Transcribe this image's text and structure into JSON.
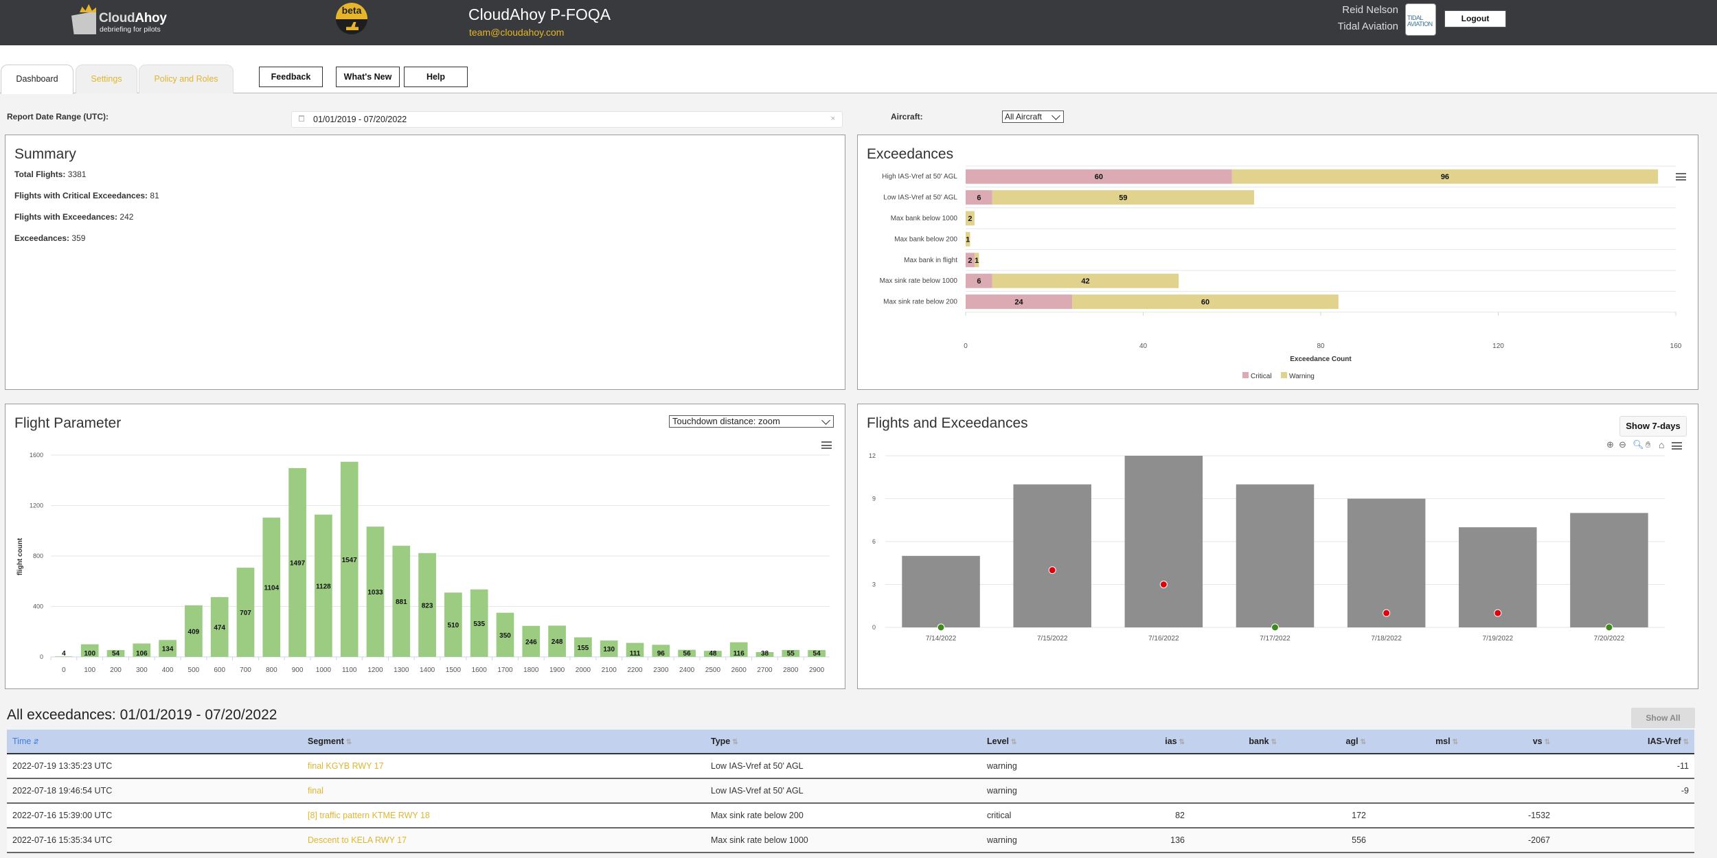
{
  "header": {
    "brand": "Cloud",
    "brand_bold": "Ahoy",
    "tagline": "debriefing for pilots",
    "beta_label": "beta",
    "app_title": "CloudAhoy P-FOQA",
    "contact_email": "team@cloudahoy.com",
    "user_name": "Reid Nelson",
    "organization": "Tidal Aviation",
    "org_logo_text": "TIDAL AVIATION",
    "logout_label": "Logout"
  },
  "tabs": [
    {
      "label": "Dashboard",
      "active": true
    },
    {
      "label": "Settings",
      "active": false
    },
    {
      "label": "Policy and Roles",
      "active": false
    }
  ],
  "top_buttons": [
    "Feedback",
    "What's New",
    "Help"
  ],
  "filters": {
    "date_range_label": "Report Date Range (UTC):",
    "date_range_value": "01/01/2019 - 07/20/2022",
    "clear_label": "×",
    "aircraft_label": "Aircraft:",
    "aircraft_value": "All Aircraft"
  },
  "summary": {
    "title": "Summary",
    "items": [
      {
        "label": "Total Flights:",
        "value": "3381"
      },
      {
        "label": "Flights with Critical Exceedances:",
        "value": "81"
      },
      {
        "label": "Flights with Exceedances:",
        "value": "242"
      },
      {
        "label": "Exceedances:",
        "value": "359"
      }
    ]
  },
  "flight_parameter": {
    "title": "Flight Parameter",
    "selected_parameter": "Touchdown distance: zoom"
  },
  "flights_exceedances": {
    "title": "Flights and Exceedances",
    "show_button": "Show 7-days",
    "tools": [
      "zoom-in",
      "zoom-out",
      "selection-zoom",
      "pan",
      "reset-home",
      "menu"
    ]
  },
  "chart_data": [
    {
      "id": "exceedances",
      "type": "bar",
      "orientation": "horizontal",
      "stacked": true,
      "title": "Exceedances",
      "categories": [
        "High IAS-Vref at 50' AGL",
        "Low IAS-Vref at 50' AGL",
        "Max bank below 1000",
        "Max bank below 200",
        "Max bank in flight",
        "Max sink rate below 1000",
        "Max sink rate below 200"
      ],
      "series": [
        {
          "name": "Critical",
          "color": "#dbaab3",
          "values": [
            60,
            6,
            0,
            0,
            2,
            6,
            24
          ]
        },
        {
          "name": "Warning",
          "color": "#e1d28e",
          "values": [
            96,
            59,
            2,
            1,
            1,
            42,
            60
          ]
        }
      ],
      "xlabel": "Exceedance Count",
      "xlim": [
        0,
        160
      ],
      "xticks": [
        0,
        40,
        80,
        120,
        160
      ],
      "legend": "bottom-center",
      "grid": true
    },
    {
      "id": "flight_parameter",
      "type": "bar",
      "title": "Touchdown distance: zoom",
      "categories": [
        "0",
        "100",
        "200",
        "300",
        "400",
        "500",
        "600",
        "700",
        "800",
        "900",
        "1000",
        "1100",
        "1200",
        "1300",
        "1400",
        "1500",
        "1600",
        "1700",
        "1800",
        "1900",
        "2000",
        "2100",
        "2200",
        "2300",
        "2400",
        "2500",
        "2600",
        "2700",
        "2800",
        "2900"
      ],
      "values": [
        4,
        100,
        54,
        106,
        134,
        409,
        474,
        707,
        1104,
        1497,
        1128,
        1547,
        1033,
        881,
        823,
        510,
        535,
        350,
        246,
        248,
        155,
        130,
        111,
        96,
        56,
        48,
        116,
        38,
        55,
        54
      ],
      "color": "#9ccc82",
      "xlabel": "",
      "ylabel": "flight count",
      "ylim": [
        0,
        1600
      ],
      "yticks": [
        0,
        400,
        800,
        1200,
        1600
      ],
      "grid": true
    },
    {
      "id": "flights_and_exceedances",
      "type": "bar",
      "title": "Flights and Exceedances",
      "categories": [
        "7/14/2022",
        "7/15/2022",
        "7/16/2022",
        "7/17/2022",
        "7/18/2022",
        "7/19/2022",
        "7/20/2022"
      ],
      "series": [
        {
          "name": "Flights",
          "type": "bar",
          "color": "#8e8e8e",
          "values": [
            5,
            10,
            12,
            10,
            9,
            7,
            8
          ]
        },
        {
          "name": "Exceedances",
          "type": "scatter",
          "values": [
            0,
            4,
            3,
            0,
            1,
            1,
            0
          ],
          "color_none": "#3f8a1e",
          "color_some": "#e0000a"
        }
      ],
      "ylim": [
        0,
        12
      ],
      "yticks": [
        0,
        3,
        6,
        9,
        12
      ],
      "grid": true
    }
  ],
  "exceedance_table": {
    "title": "All exceedances: 01/01/2019 - 07/20/2022",
    "show_all_label": "Show All",
    "columns": [
      {
        "label": "Time",
        "arrow": "⇵",
        "sorted": true
      },
      {
        "label": "Segment",
        "arrow": "⇅"
      },
      {
        "label": "Type",
        "arrow": "⇅"
      },
      {
        "label": "Level",
        "arrow": "⇅"
      },
      {
        "label": "ias",
        "arrow": "⇅"
      },
      {
        "label": "bank",
        "arrow": "⇅"
      },
      {
        "label": "agl",
        "arrow": "⇅"
      },
      {
        "label": "msl",
        "arrow": "⇅"
      },
      {
        "label": "vs",
        "arrow": "⇅"
      },
      {
        "label": "IAS-Vref",
        "arrow": "⇅"
      }
    ],
    "rows": [
      {
        "time": "2022-07-19 13:35:23 UTC",
        "segment": "final KGYB RWY 17",
        "type": "Low IAS-Vref at 50' AGL",
        "level": "warning",
        "ias": "",
        "bank": "",
        "agl": "",
        "msl": "",
        "vs": "",
        "ias_vref": "-11"
      },
      {
        "time": "2022-07-18 19:46:54 UTC",
        "segment": "final",
        "type": "Low IAS-Vref at 50' AGL",
        "level": "warning",
        "ias": "",
        "bank": "",
        "agl": "",
        "msl": "",
        "vs": "",
        "ias_vref": "-9"
      },
      {
        "time": "2022-07-16 15:39:00 UTC",
        "segment": "[8] traffic pattern KTME RWY 18",
        "type": "Max sink rate below 200",
        "level": "critical",
        "ias": "82",
        "bank": "",
        "agl": "172",
        "msl": "",
        "vs": "-1532",
        "ias_vref": ""
      },
      {
        "time": "2022-07-16 15:35:34 UTC",
        "segment": "Descent to KELA RWY 17",
        "type": "Max sink rate below 1000",
        "level": "warning",
        "ias": "136",
        "bank": "",
        "agl": "556",
        "msl": "",
        "vs": "-2067",
        "ias_vref": ""
      }
    ]
  }
}
